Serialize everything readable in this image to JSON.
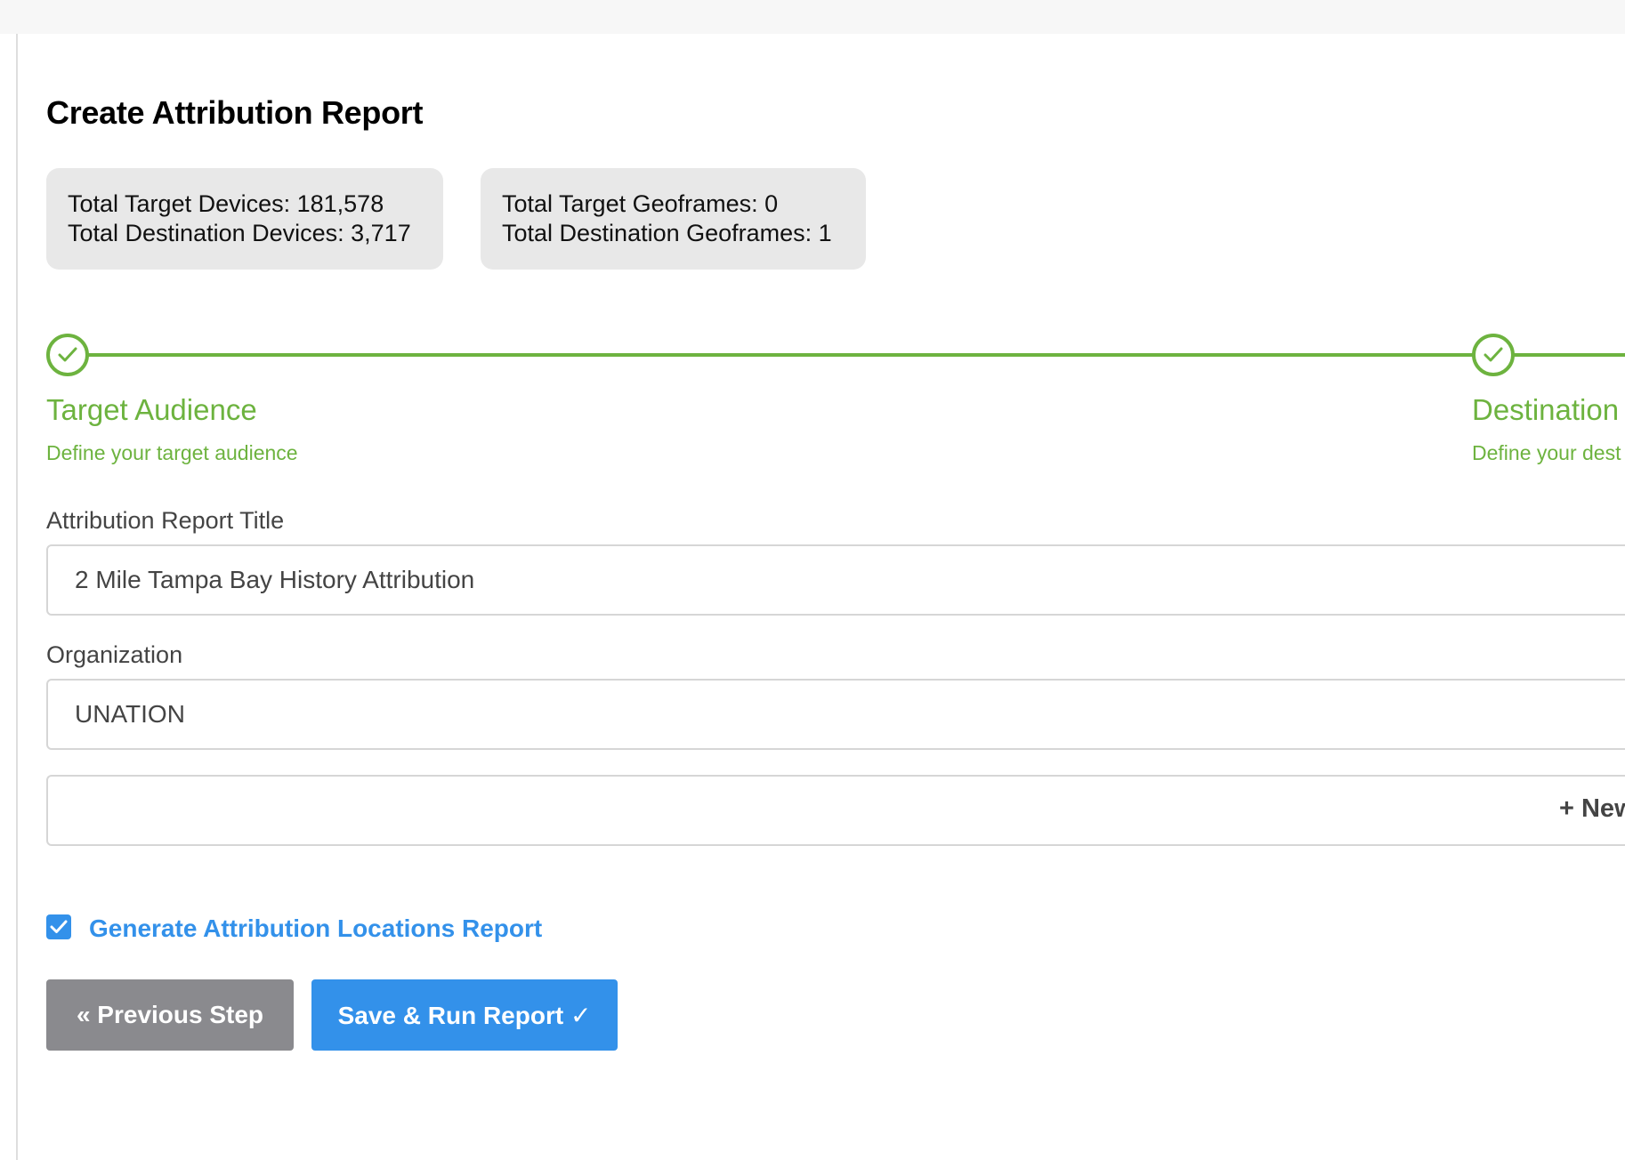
{
  "page": {
    "title": "Create Attribution Report"
  },
  "stats": {
    "box1": {
      "line1": "Total Target Devices: 181,578",
      "line2": "Total Destination Devices: 3,717"
    },
    "box2": {
      "line1": "Total Target Geoframes: 0",
      "line2": "Total Destination Geoframes: 1"
    }
  },
  "steps": [
    {
      "title": "Target Audience",
      "description": "Define your target audience",
      "status": "complete",
      "icon": "check-icon"
    },
    {
      "title": "Destination A",
      "description": "Define your dest",
      "status": "complete",
      "icon": "check-icon"
    }
  ],
  "form": {
    "title_label": "Attribution Report Title",
    "title_value": "2 Mile Tampa Bay History Attribution",
    "organization_label": "Organization",
    "organization_value": "UNATION",
    "new_link": "+ New"
  },
  "options": {
    "generate_locations_label": "Generate Attribution Locations Report",
    "generate_locations_checked": true
  },
  "buttons": {
    "previous": "« Previous Step",
    "save_run": "Save & Run Report ✓"
  },
  "colors": {
    "step_complete": "#6db33f",
    "primary": "#3391ea",
    "secondary_button": "#8a8a8e",
    "stat_box_bg": "#e8e8e8"
  }
}
